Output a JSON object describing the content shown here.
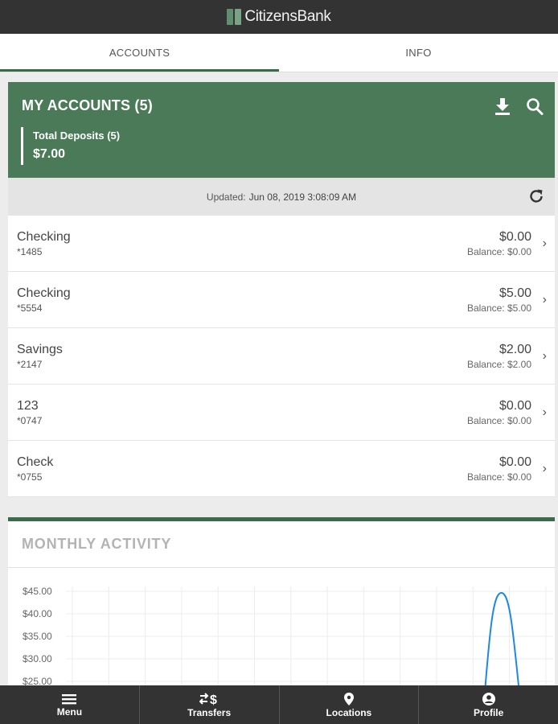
{
  "app": {
    "brand": "CitizensBank"
  },
  "tabs": [
    {
      "label": "ACCOUNTS",
      "active": true
    },
    {
      "label": "INFO",
      "active": false
    }
  ],
  "accounts_card": {
    "title": "MY ACCOUNTS (5)",
    "deposits_label": "Total Deposits (5)",
    "deposits_value": "$7.00",
    "updated_prefix": "Updated:",
    "updated_time": "Jun 08, 2019 3:08:09 AM",
    "accent_color": "#4a7a57"
  },
  "accounts": [
    {
      "name": "Checking",
      "number": "*1485",
      "amount": "$0.00",
      "balance": "Balance: $0.00"
    },
    {
      "name": "Checking",
      "number": "*5554",
      "amount": "$5.00",
      "balance": "Balance: $5.00"
    },
    {
      "name": "Savings",
      "number": "*2147",
      "amount": "$2.00",
      "balance": "Balance: $2.00"
    },
    {
      "name": "123",
      "number": "*0747",
      "amount": "$0.00",
      "balance": "Balance: $0.00"
    },
    {
      "name": "Check",
      "number": "*0755",
      "amount": "$0.00",
      "balance": "Balance: $0.00"
    }
  ],
  "activity": {
    "title": "MONTHLY ACTIVITY",
    "y_ticks": [
      "$45.00",
      "$40.00",
      "$35.00",
      "$30.00",
      "$25.00"
    ],
    "line_color": "#1e88e5"
  },
  "chart_data": {
    "type": "line",
    "title": "MONTHLY ACTIVITY",
    "ylim": [
      25,
      45
    ],
    "y_ticks": [
      45,
      40,
      35,
      30,
      25
    ],
    "x": [
      0,
      1,
      2,
      3,
      4,
      5,
      6,
      7,
      8,
      9,
      10,
      11,
      12
    ],
    "values": [
      null,
      null,
      null,
      null,
      null,
      null,
      null,
      null,
      null,
      null,
      null,
      null,
      45
    ],
    "grid": true
  },
  "bottom_nav": [
    {
      "label": "Menu",
      "icon": "menu-icon"
    },
    {
      "label": "Transfers",
      "icon": "transfers-icon"
    },
    {
      "label": "Locations",
      "icon": "location-pin-icon"
    },
    {
      "label": "Profile",
      "icon": "profile-icon"
    }
  ]
}
